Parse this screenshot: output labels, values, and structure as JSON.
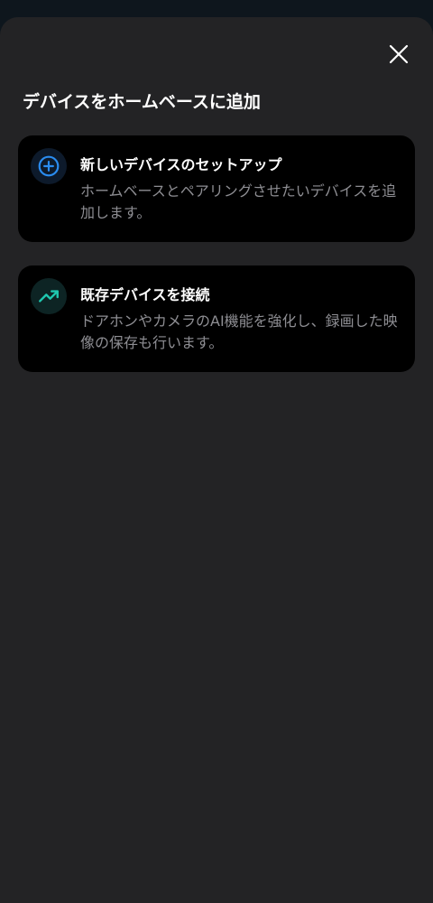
{
  "sheet": {
    "title": "デバイスをホームベースに追加",
    "close_icon": "close-icon"
  },
  "options": [
    {
      "icon": "add-circle-icon",
      "icon_color": "#2a8cf0",
      "title": "新しいデバイスのセットアップ",
      "description": "ホームベースとペアリングさせたいデバイスを追加します。"
    },
    {
      "icon": "trending-up-icon",
      "icon_color": "#1fc8b0",
      "title": "既存デバイスを接続",
      "description": "ドアホンやカメラのAI機能を強化し、録画した映像の保存も行います。"
    }
  ]
}
